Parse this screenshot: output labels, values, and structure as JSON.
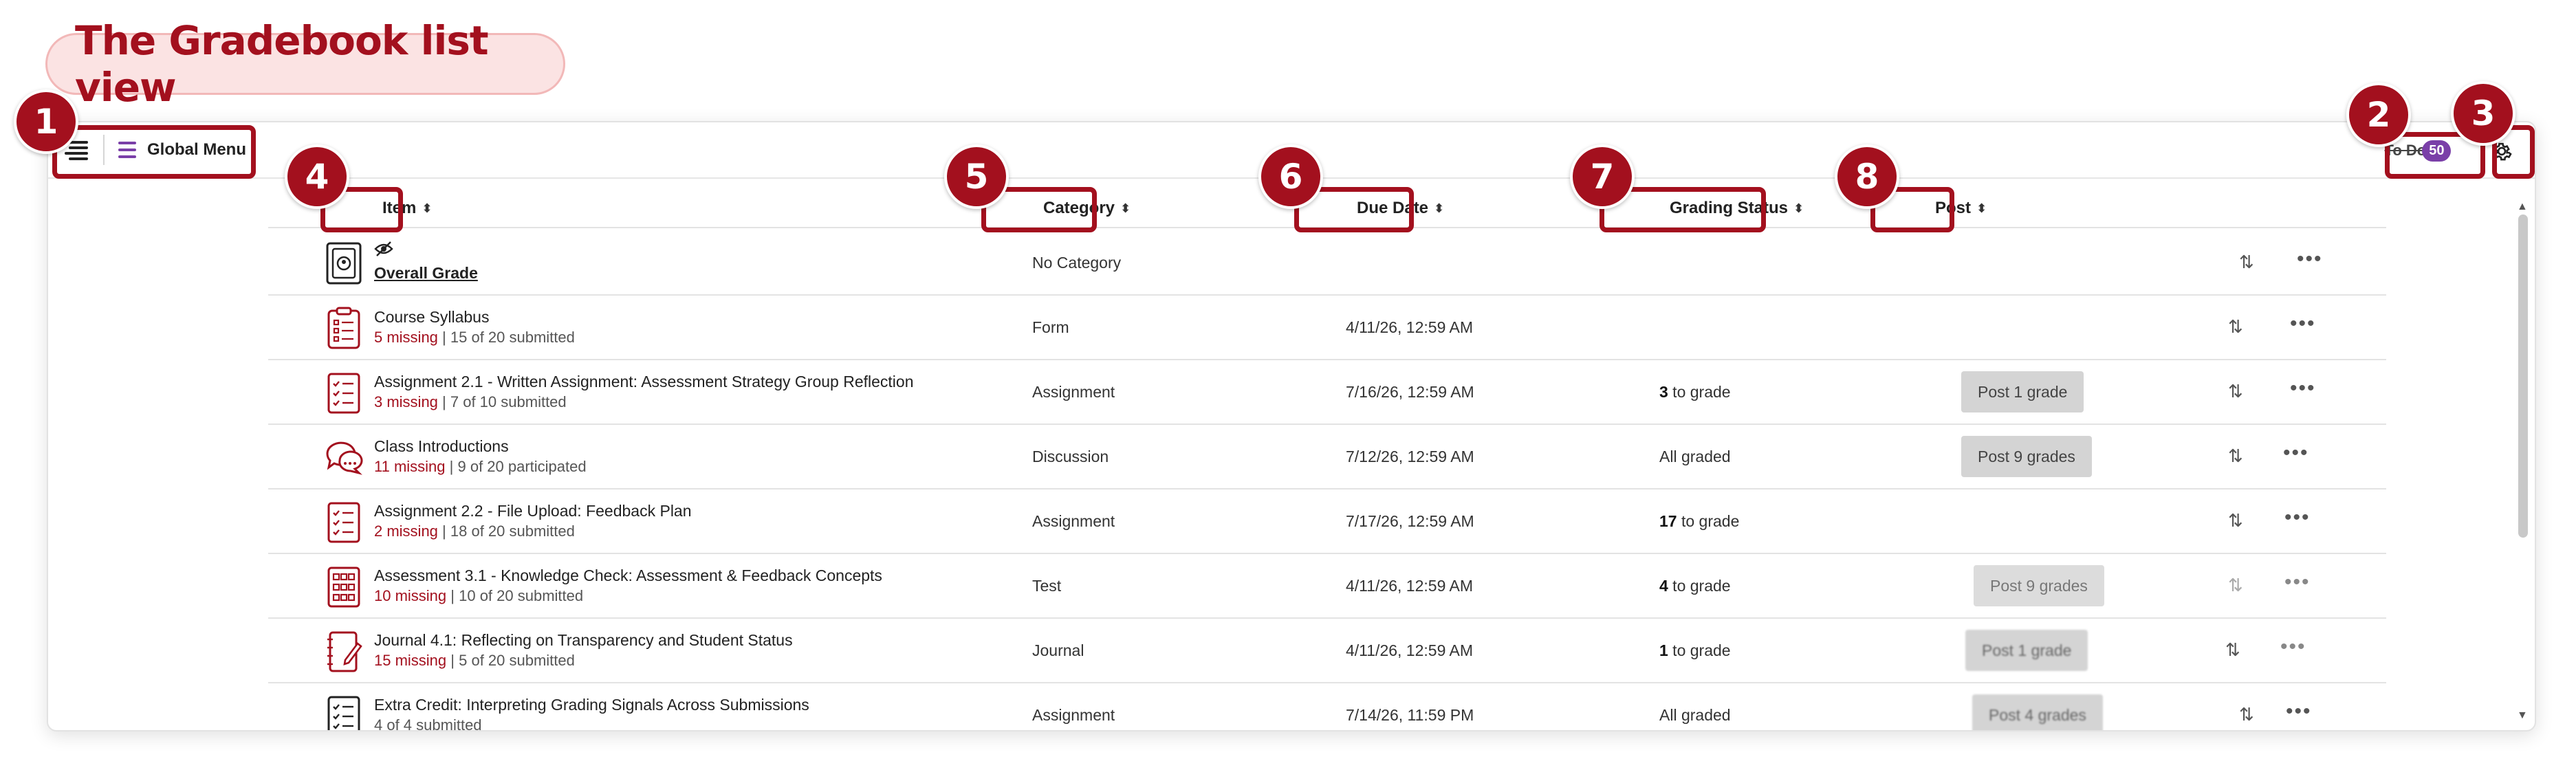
{
  "title": "The Gradebook list view",
  "topbar": {
    "global_menu_label": "Global Menu",
    "todo_label": "To Do",
    "todo_count": "50"
  },
  "columns": {
    "item": "Item",
    "category": "Category",
    "due_date": "Due Date",
    "grading_status": "Grading Status",
    "post": "Post"
  },
  "callouts": [
    "1",
    "2",
    "3",
    "4",
    "5",
    "6",
    "7",
    "8"
  ],
  "rows": [
    {
      "icon": "overall-grade-icon",
      "name": "Overall Grade",
      "missing": "",
      "submitted": "",
      "category": "No Category",
      "due": "",
      "status_num": "",
      "status_text": "",
      "post": ""
    },
    {
      "icon": "form-icon",
      "name": "Course Syllabus",
      "missing": "5 missing",
      "submitted": "15 of 20 submitted",
      "category": "Form",
      "due": "4/11/26, 12:59 AM",
      "status_num": "",
      "status_text": "",
      "post": ""
    },
    {
      "icon": "assignment-icon",
      "name": "Assignment 2.1 - Written Assignment: Assessment Strategy Group Reflection",
      "missing": "3 missing",
      "submitted": "7 of 10 submitted",
      "category": "Assignment",
      "due": "7/16/26, 12:59 AM",
      "status_num": "3",
      "status_text": " to grade",
      "post": "Post 1 grade"
    },
    {
      "icon": "discussion-icon",
      "name": "Class Introductions",
      "missing": "11 missing",
      "submitted": "9 of 20 participated",
      "category": "Discussion",
      "due": "7/12/26, 12:59 AM",
      "status_num": "",
      "status_text": "All graded",
      "post": "Post 9 grades"
    },
    {
      "icon": "assignment-icon",
      "name": "Assignment 2.2 - File Upload: Feedback Plan",
      "missing": "2 missing",
      "submitted": "18 of 20 submitted",
      "category": "Assignment",
      "due": "7/17/26, 12:59 AM",
      "status_num": "17",
      "status_text": " to grade",
      "post": ""
    },
    {
      "icon": "test-icon",
      "name": "Assessment 3.1 - Knowledge Check: Assessment & Feedback Concepts",
      "missing": "10 missing",
      "submitted": "10 of 20 submitted",
      "category": "Test",
      "due": "4/11/26, 12:59 AM",
      "status_num": "4",
      "status_text": " to grade",
      "post": "Post 9 grades"
    },
    {
      "icon": "journal-icon",
      "name": "Journal 4.1: Reflecting on Transparency and Student Status",
      "missing": "15 missing",
      "submitted": "5 of 20 submitted",
      "category": "Journal",
      "due": "4/11/26, 12:59 AM",
      "status_num": "1",
      "status_text": " to grade",
      "post": "Post 1 grade"
    },
    {
      "icon": "assignment-icon",
      "name": "Extra Credit: Interpreting Grading Signals Across Submissions",
      "missing": "",
      "submitted": "4 of 4 submitted",
      "category": "Assignment",
      "due": "7/14/26, 11:59 PM",
      "status_num": "",
      "status_text": "All graded",
      "post": "Post 4 grades"
    }
  ],
  "colors": {
    "accent": "#a3101e",
    "brand_purple": "#7a3fa8",
    "missing": "#a3101e"
  }
}
